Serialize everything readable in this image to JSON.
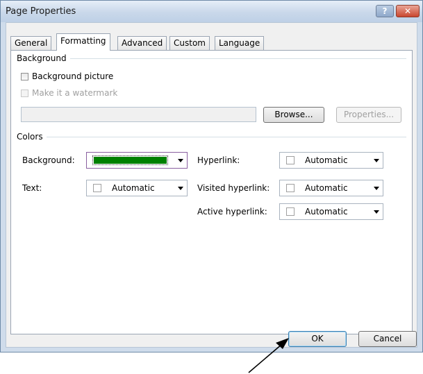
{
  "window": {
    "title": "Page Properties"
  },
  "tabs": [
    {
      "label": "General"
    },
    {
      "label": "Formatting"
    },
    {
      "label": "Advanced"
    },
    {
      "label": "Custom"
    },
    {
      "label": "Language"
    }
  ],
  "background_group": {
    "label": "Background",
    "picture_check": "Background picture",
    "watermark_check": "Make it a watermark",
    "path_value": "",
    "browse": "Browse...",
    "properties": "Properties..."
  },
  "colors_group": {
    "label": "Colors",
    "background_label": "Background:",
    "background_color": "#008000",
    "text_label": "Text:",
    "text_value": "Automatic",
    "hyperlink_label": "Hyperlink:",
    "hyperlink_value": "Automatic",
    "visited_label": "Visited hyperlink:",
    "visited_value": "Automatic",
    "active_label": "Active hyperlink:",
    "active_value": "Automatic"
  },
  "footer": {
    "ok": "OK",
    "cancel": "Cancel"
  }
}
